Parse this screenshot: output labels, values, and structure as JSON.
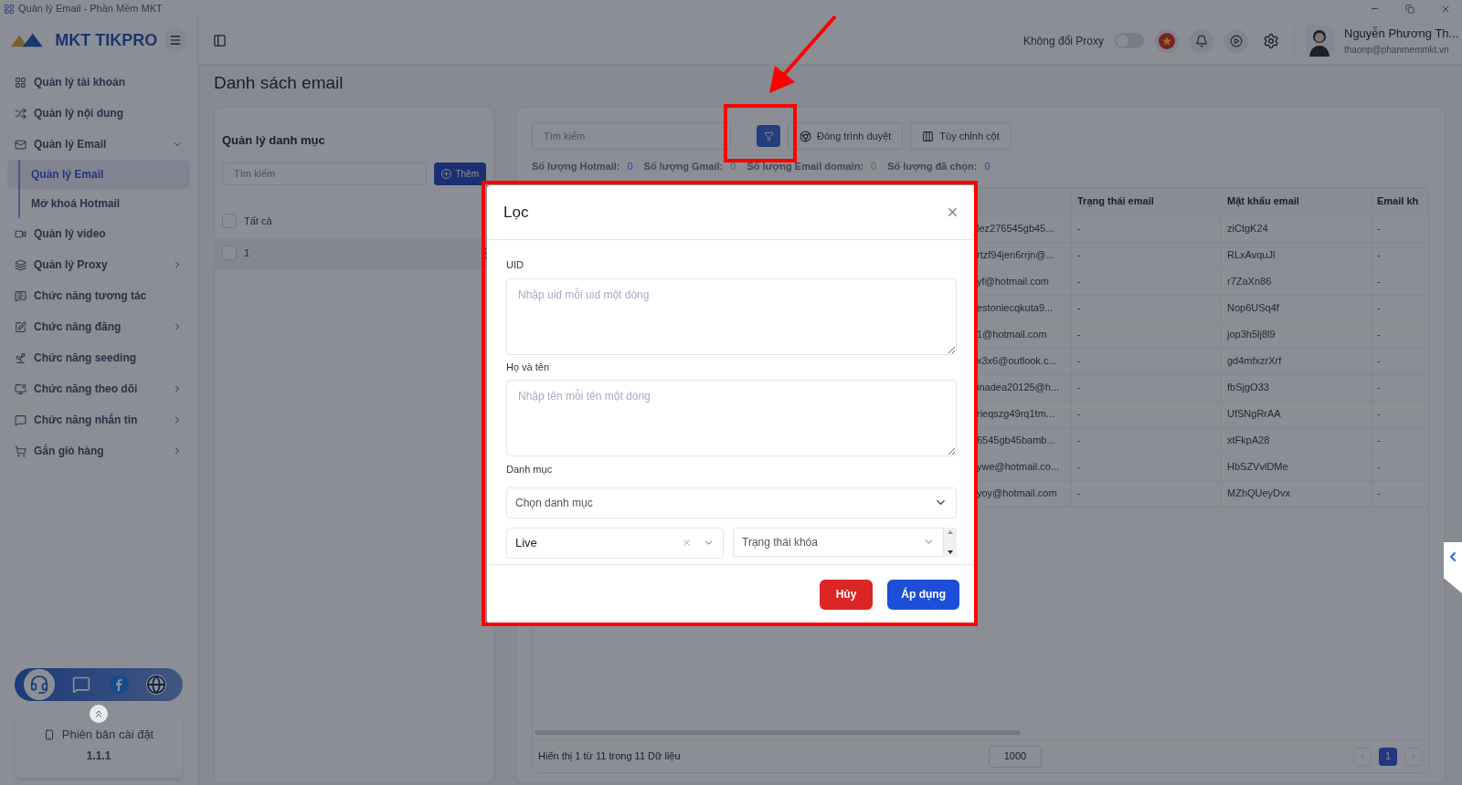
{
  "window": {
    "title": "Quản lý Email - Phần Mềm MKT"
  },
  "sidebar": {
    "logo": "MKT TIKPRO",
    "items": [
      {
        "label": "Quản lý tài khoản"
      },
      {
        "label": "Quản lý nội dung"
      },
      {
        "label": "Quản lý Email",
        "expanded": true,
        "children": [
          {
            "label": "Quản lý Email",
            "selected": true
          },
          {
            "label": "Mở khoá Hotmail",
            "selected": false
          }
        ]
      },
      {
        "label": "Quản lý video"
      },
      {
        "label": "Quản lý Proxy",
        "expanded": false
      },
      {
        "label": "Chức năng tương tác"
      },
      {
        "label": "Chức năng đăng",
        "expanded": false
      },
      {
        "label": "Chức năng seeding"
      },
      {
        "label": "Chức năng theo dõi",
        "expanded": false
      },
      {
        "label": "Chức năng nhắn tin",
        "expanded": false
      },
      {
        "label": "Gắn giỏ hàng",
        "expanded": false
      }
    ],
    "version": {
      "label": "Phiên bản cài đặt",
      "value": "1.1.1"
    }
  },
  "header": {
    "proxy_toggle": {
      "label": "Không đổi Proxy",
      "on": false
    },
    "user": {
      "name": "Nguyễn Phương Th...",
      "email": "thaonp@phanmemmkt.vn"
    }
  },
  "page_title": "Danh sách email",
  "category_panel": {
    "title": "Quản lý danh mục",
    "search_placeholder": "Tìm kiếm",
    "add_button": "Thêm",
    "items": [
      {
        "label": "Tất cả",
        "checked": false,
        "selected": false
      },
      {
        "label": "1",
        "checked": false,
        "selected": true
      }
    ]
  },
  "email_panel": {
    "search_placeholder": "Tìm kiếm",
    "filter_active": true,
    "buttons": [
      "Đóng trình duyệt",
      "Tùy chỉnh cột"
    ],
    "stats": [
      {
        "label": "Số lượng Hotmail:",
        "value": "0",
        "color": "#2b47a8"
      },
      {
        "label": "Số lượng Gmail:",
        "value": "0",
        "color": "#3a7a4a"
      },
      {
        "label": "Số lượng Email domain:",
        "value": "0",
        "color": "#3a7a4a"
      },
      {
        "label": "Số lượng đã chọn:",
        "value": "0",
        "color": "#2b47a8"
      }
    ],
    "table": {
      "columns": [
        "",
        "Trạng thái email",
        "Mật khẩu email",
        "Email kh"
      ],
      "rows": [
        [
          "lez276545gb45...",
          "-",
          "ziCtgK24",
          "-"
        ],
        [
          "rtzf94jen6rrjn@...",
          "-",
          "RLxAvquJl",
          "-"
        ],
        [
          "yf@hotmail.com",
          "-",
          "r7ZaXn86",
          "-"
        ],
        [
          "estoniecqkuta9...",
          "-",
          "Nop6USq4f",
          "-"
        ],
        [
          "1@hotmail.com",
          "-",
          "jop3h5lj8l9",
          "-"
        ],
        [
          "x3x6@outlook.c...",
          "-",
          "gd4mfxzrXrf",
          "-"
        ],
        [
          "inadea20125@h...",
          "-",
          "fbSjgO33",
          "-"
        ],
        [
          "rieqszg49rq1tm...",
          "-",
          "UfSNgRrAA",
          "-"
        ],
        [
          "6545gb45bamb...",
          "-",
          "xtFkpA28",
          "-"
        ],
        [
          "ywe@hotmail.co...",
          "-",
          "HbSZVvlDMe",
          "-"
        ],
        [
          "yoy@hotmail.com",
          "-",
          "MZhQUeyDvx",
          "-"
        ]
      ]
    },
    "footer": {
      "summary": "Hiển thị 1 từ 11 trong 11 Dữ liệu",
      "page_size": "1000",
      "pages": [
        {
          "label": "1",
          "selected": true
        }
      ]
    }
  },
  "filter_dialog": {
    "title": "Lọc",
    "uid": {
      "label": "UID",
      "placeholder": "Nhập uid mỗi uid một dòng"
    },
    "name": {
      "label": "Họ và tên",
      "placeholder": "Nhập tên mỗi tên một dòng"
    },
    "category": {
      "label": "Danh mục",
      "placeholder": "Chọn danh mục"
    },
    "status": {
      "value": "Live"
    },
    "lock_status": {
      "placeholder": "Trạng thái khóa"
    },
    "cancel_button": "Hủy",
    "apply_button": "Áp dụng"
  }
}
